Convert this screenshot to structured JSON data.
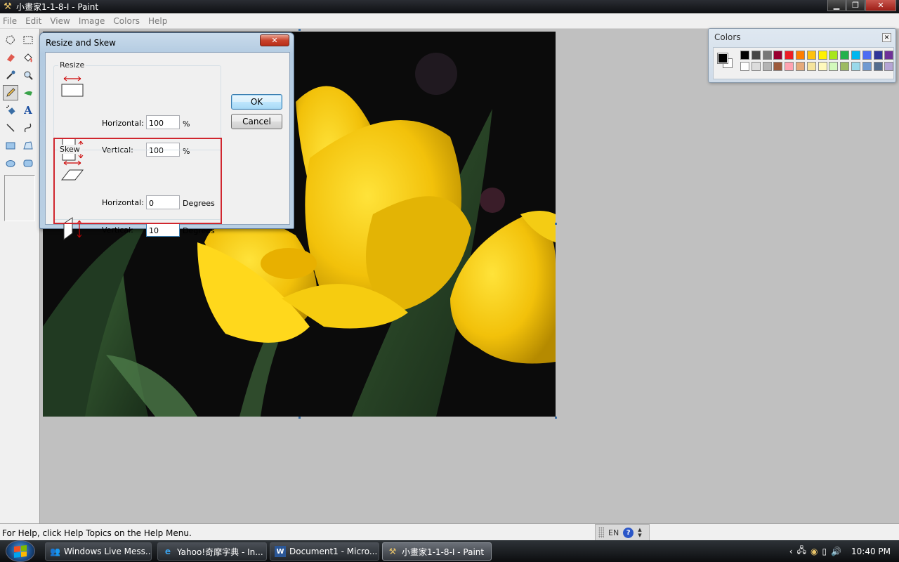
{
  "window": {
    "title": "小畫家1-1-8-I - Paint"
  },
  "menu": [
    "File",
    "Edit",
    "View",
    "Image",
    "Colors",
    "Help"
  ],
  "dialog": {
    "title": "Resize and Skew",
    "resize_label": "Resize",
    "skew_label": "Skew",
    "horizontal_label": "Horizontal:",
    "vertical_label": "Vertical:",
    "resize_horizontal": "100",
    "resize_vertical": "100",
    "percent": "%",
    "skew_horizontal": "0",
    "skew_vertical": "10",
    "degrees": "Degrees",
    "ok": "OK",
    "cancel": "Cancel"
  },
  "colors_panel": {
    "title": "Colors",
    "row1": [
      "#000000",
      "#464646",
      "#787878",
      "#990030",
      "#ed1c24",
      "#ff7e00",
      "#ffc20e",
      "#fff200",
      "#a8e61d",
      "#22b14c",
      "#00b7ef",
      "#4d6df3",
      "#2f3699",
      "#6f3198"
    ],
    "row2": [
      "#ffffff",
      "#dcdcdc",
      "#b4b4b4",
      "#9c5a3c",
      "#ffa3b1",
      "#e5aa7a",
      "#f5e49c",
      "#fff9bd",
      "#d3f9bc",
      "#9dbb61",
      "#99d9ea",
      "#709ad1",
      "#546d8e",
      "#b5a5d5"
    ]
  },
  "status": {
    "text": "For Help, click Help Topics on the Help Menu.",
    "lang": "EN",
    "help": "?"
  },
  "taskbar": {
    "items": [
      {
        "label": "Windows Live Mess...",
        "icon": "messenger-icon"
      },
      {
        "label": "Yahoo!奇摩字典 - In...",
        "icon": "ie-icon"
      },
      {
        "label": "Document1 - Micro...",
        "icon": "word-icon"
      },
      {
        "label": "小畫家1-1-8-I - Paint",
        "icon": "paint-icon"
      }
    ],
    "clock": "10:40 PM"
  }
}
